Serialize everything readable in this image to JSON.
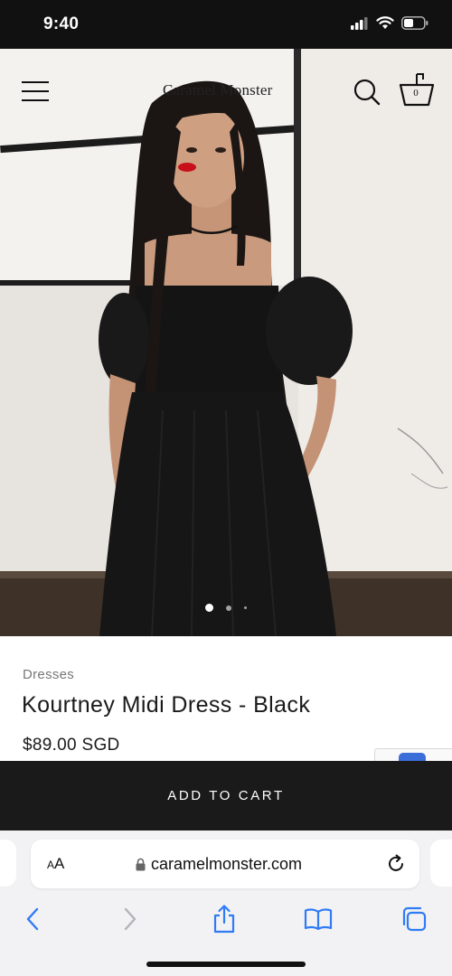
{
  "status_bar": {
    "time": "9:40"
  },
  "header": {
    "brand": "Caramel Monster",
    "cart_count": "0"
  },
  "gallery": {
    "slides": 3,
    "active_slide": 1
  },
  "product": {
    "category": "Dresses",
    "name": "Kourtney Midi Dress - Black",
    "price": "$89.00 SGD"
  },
  "actions": {
    "add_to_cart": "ADD TO CART"
  },
  "browser": {
    "text_size_label_small": "A",
    "text_size_label_large": "A",
    "url": "caramelmonster.com"
  },
  "icons": [
    "menu-icon",
    "search-icon",
    "cart-icon",
    "lock-icon",
    "reload-icon",
    "back-icon",
    "forward-icon",
    "share-icon",
    "bookmarks-icon",
    "tabs-icon"
  ],
  "colors": {
    "accent": "#2f7bf6",
    "bar": "#1a1a1a"
  }
}
